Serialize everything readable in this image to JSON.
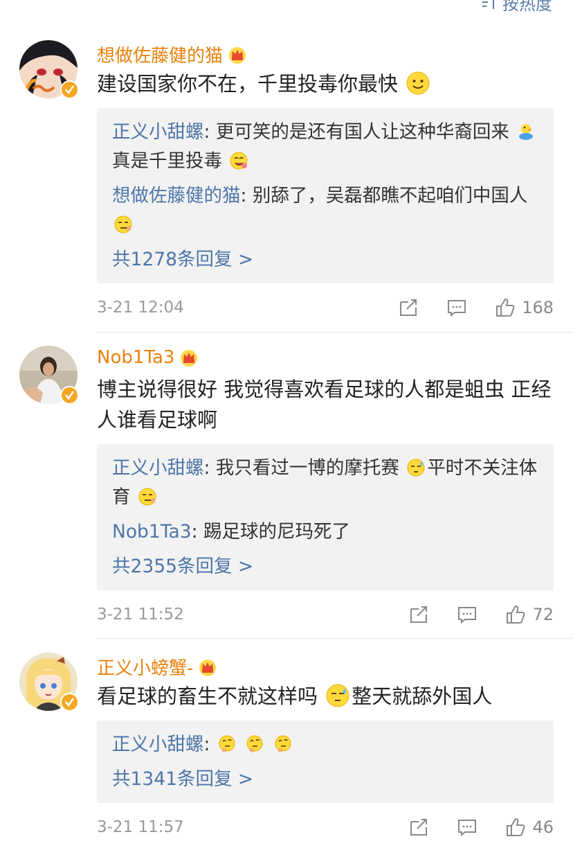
{
  "sort": {
    "label": "按热度"
  },
  "comments": [
    {
      "username": "想做佐藤健的猫",
      "text": "建设国家你不在，千里投毒你最快",
      "replies": [
        {
          "name": "正义小甜螺",
          "text_a": ": 更可笑的是还有国人让这种华裔回来",
          "text_b": "真是千里投毒"
        },
        {
          "name": "想做佐藤健的猫",
          "text_a": ": 别舔了，吴磊都瞧不起咱们中国人",
          "text_b": ""
        }
      ],
      "more": "共1278条回复 >",
      "time": "3-21 12:04",
      "likes": "168"
    },
    {
      "username": "Nob1Ta3",
      "text": "博主说得很好 我觉得喜欢看足球的人都是蛆虫 正经人谁看足球啊",
      "replies": [
        {
          "name": "正义小甜螺",
          "text_a": ": 我只看过一博的摩托赛",
          "text_b": "平时不关注体育"
        },
        {
          "name": "Nob1Ta3",
          "text_a": ": 踢足球的尼玛死了",
          "text_b": ""
        }
      ],
      "more": "共2355条回复 >",
      "time": "3-21 11:52",
      "likes": "72"
    },
    {
      "username": "正义小螃蟹-",
      "text_a": "看足球的畜生不就这样吗",
      "text_b": "整天就舔外国人",
      "replies": [
        {
          "name": "正义小甜螺",
          "text_a": ": ",
          "text_b": ""
        }
      ],
      "more": "共1341条回复 >",
      "time": "3-21 11:57",
      "likes": "46"
    }
  ],
  "icons": {
    "share": "share-icon",
    "comment": "comment-icon",
    "like": "like-icon",
    "crown": "vip-crown-icon",
    "verify": "verified-badge-icon"
  },
  "colors": {
    "username": "#e8820c",
    "reply_name": "#4d76a8",
    "reply_bg": "#f2f2f2",
    "meta": "#999999"
  }
}
